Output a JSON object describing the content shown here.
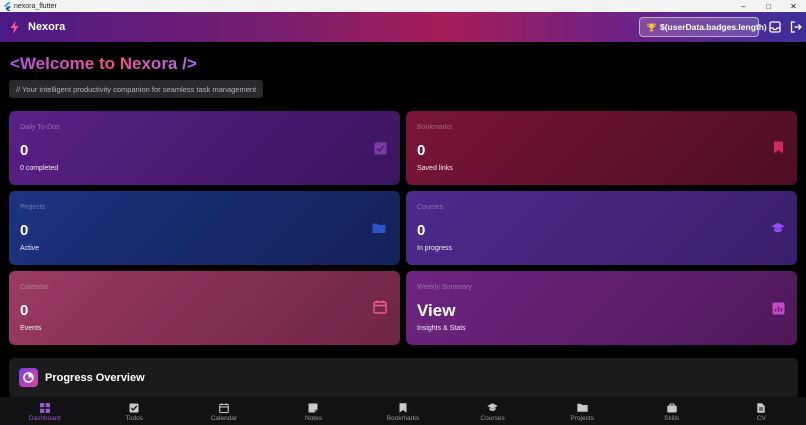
{
  "window": {
    "title": "nexora_flutter",
    "controls": [
      "–",
      "□",
      "✕"
    ]
  },
  "appbar": {
    "name": "Nexora",
    "badge_text": "$(userData.badges.length)"
  },
  "header": {
    "welcome": "<Welcome to Nexora />",
    "subtitle": "// Your intelligent productivity companion for seamless task management"
  },
  "cards": [
    {
      "label": "Daily To-Dos",
      "value": "0",
      "sub": "0 completed",
      "icon": "checkbox-icon",
      "color": "#4c1d6e"
    },
    {
      "label": "Bookmarks",
      "value": "0",
      "sub": "Saved links",
      "icon": "bookmark-icon",
      "color": "#6b1130"
    },
    {
      "label": "Projects",
      "value": "0",
      "sub": "Active",
      "icon": "folder-icon",
      "color": "#1a2a6e"
    },
    {
      "label": "Courses",
      "value": "0",
      "sub": "In progress",
      "icon": "graduation-cap-icon",
      "color": "#44237e"
    },
    {
      "label": "Calendar",
      "value": "0",
      "sub": "Events",
      "icon": "calendar-icon",
      "color": "#8a3257"
    },
    {
      "label": "Weekly Summary",
      "value": "View",
      "sub": "Insights & Stats",
      "icon": "chart-icon",
      "color": "#5e1f6c"
    }
  ],
  "progress": {
    "title": "Progress Overview"
  },
  "nav": [
    {
      "label": "Dashboard",
      "icon": "dashboard-icon",
      "active": true
    },
    {
      "label": "Todos",
      "icon": "checkbox-icon"
    },
    {
      "label": "Calendar",
      "icon": "calendar-icon"
    },
    {
      "label": "Notes",
      "icon": "note-icon"
    },
    {
      "label": "Bookmarks",
      "icon": "bookmark-icon"
    },
    {
      "label": "Courses",
      "icon": "graduation-cap-icon"
    },
    {
      "label": "Projects",
      "icon": "folder-icon"
    },
    {
      "label": "Skills",
      "icon": "briefcase-icon"
    },
    {
      "label": "CV",
      "icon": "document-icon"
    }
  ]
}
